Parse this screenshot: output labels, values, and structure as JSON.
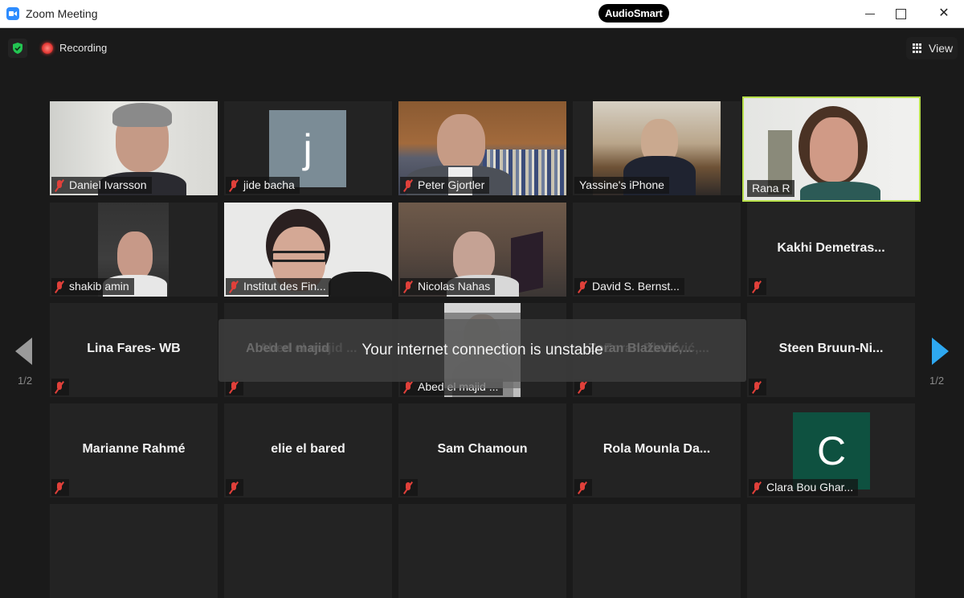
{
  "window": {
    "title": "Zoom Meeting",
    "brand_badge": "AudioSmart",
    "controls": {
      "minimize": "",
      "maximize": "",
      "close": "✕"
    }
  },
  "topbar": {
    "security_icon": "shield-check-icon",
    "recording_label": "Recording",
    "view_label": "View"
  },
  "pagination": {
    "left": "1/2",
    "right": "1/2"
  },
  "toast": {
    "message": "Your internet connection is unstable",
    "ghost_left": "Abed el majid",
    "ghost_right": "Zoran  Blažević,..."
  },
  "colors": {
    "active_speaker_border": "#b8e04a",
    "next_page_arrow": "#2ea8f0",
    "muted_icon": "#e0403a",
    "avatar_j": "#7b8c96",
    "avatar_c": "#0e5140"
  },
  "participants": [
    {
      "name": "Daniel Ivarsson",
      "type": "video",
      "muted": true
    },
    {
      "name": "jide bacha",
      "type": "avatar",
      "initial": "j",
      "muted": true
    },
    {
      "name": "Peter Gjortler",
      "type": "video",
      "muted": true
    },
    {
      "name": "Yassine's iPhone",
      "type": "video",
      "muted": false
    },
    {
      "name": "Rana R",
      "type": "video",
      "muted": false,
      "active_speaker": true
    },
    {
      "name": "shakib amin",
      "type": "video",
      "muted": true
    },
    {
      "name": "Institut des Fin...",
      "type": "video",
      "muted": true
    },
    {
      "name": "Nicolas Nahas",
      "type": "video",
      "muted": true
    },
    {
      "name": "David S. Bernst...",
      "type": "video-off",
      "muted": true
    },
    {
      "name": "Kakhi  Demetras...",
      "type": "name-only",
      "muted": true
    },
    {
      "name": "Lina Fares- WB",
      "type": "name-only",
      "muted": true
    },
    {
      "name": "Abed el majid ...",
      "type": "name-only",
      "muted": true
    },
    {
      "name": "Abed el majid ...",
      "type": "video",
      "muted": true
    },
    {
      "name": "Zoran  Blažević,...",
      "type": "name-only",
      "muted": true
    },
    {
      "name": "Steen  Bruun-Ni...",
      "type": "name-only",
      "muted": true
    },
    {
      "name": "Marianne Rahmé",
      "type": "name-only",
      "muted": true
    },
    {
      "name": "elie el bared",
      "type": "name-only",
      "muted": true
    },
    {
      "name": "Sam Chamoun",
      "type": "name-only",
      "muted": true
    },
    {
      "name": "Rola  Mounla  Da...",
      "type": "name-only",
      "muted": true
    },
    {
      "name": "Clara Bou Ghar...",
      "type": "avatar",
      "initial": "C",
      "muted": true
    }
  ]
}
